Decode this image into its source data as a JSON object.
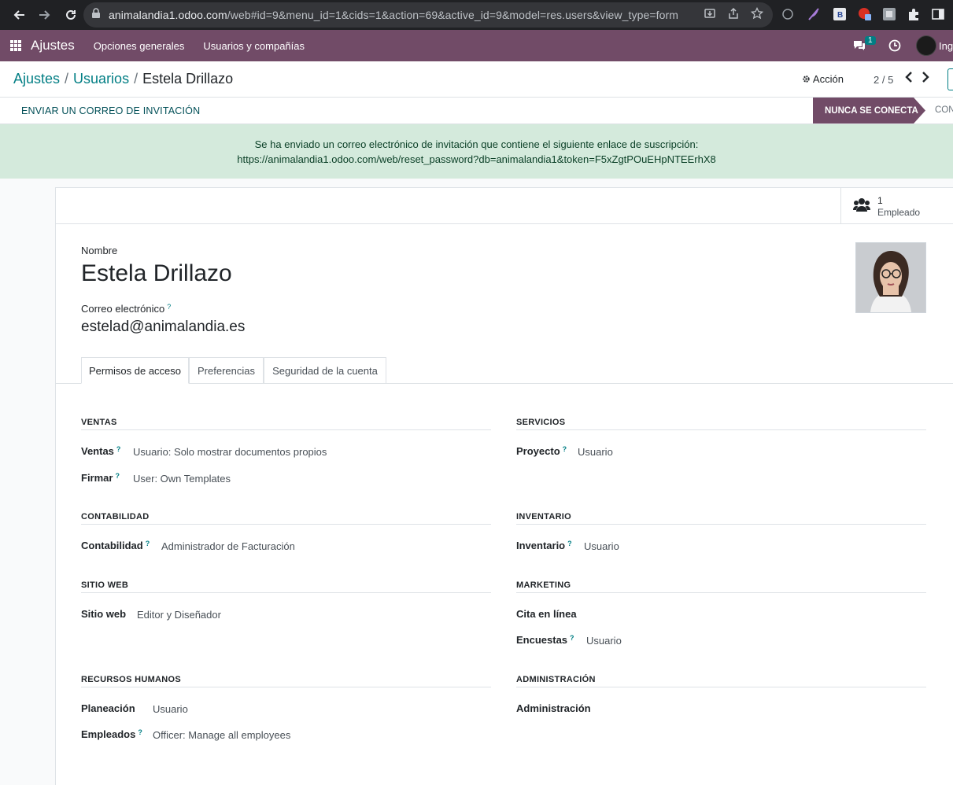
{
  "browser": {
    "url_host": "animalandia1.odoo.com",
    "url_rest": "/web#id=9&menu_id=1&cids=1&action=69&active_id=9&model=res.users&view_type=form"
  },
  "navbar": {
    "brand": "Ajustes",
    "menu": [
      "Opciones generales",
      "Usuarios y compañías"
    ],
    "chat_count": "1",
    "user_label": "Ing"
  },
  "breadcrumb": {
    "root": "Ajustes",
    "parent": "Usuarios",
    "current": "Estela Drillazo"
  },
  "control_panel": {
    "action_label": "Acción",
    "pager": "2 / 5"
  },
  "statusbar": {
    "invite_button": "ENVIAR UN CORREO DE INVITACIÓN",
    "stage_active": "NUNCA SE CONECTA",
    "stage_next": "CON"
  },
  "alert": {
    "line1": "Se ha enviado un correo electrónico de invitación que contiene el siguiente enlace de suscripción:",
    "line2": "https://animalandia1.odoo.com/web/reset_password?db=animalandia1&token=F5xZgtPOuEHpNTEErhX8"
  },
  "smart_button": {
    "count": "1",
    "label": "Empleado"
  },
  "form": {
    "name_label": "Nombre",
    "name": "Estela Drillazo",
    "email_label": "Correo electrónico",
    "email": "estelad@animalandia.es",
    "help_mark": "?"
  },
  "tabs": [
    "Permisos de acceso",
    "Preferencias",
    "Seguridad de la cuenta"
  ],
  "sections": {
    "ventas": {
      "title": "VENTAS",
      "rows": [
        {
          "label": "Ventas",
          "value": "Usuario: Solo mostrar documentos propios"
        },
        {
          "label": "Firmar",
          "value": "User: Own Templates"
        }
      ]
    },
    "servicios": {
      "title": "SERVICIOS",
      "rows": [
        {
          "label": "Proyecto",
          "value": "Usuario"
        }
      ]
    },
    "contabilidad": {
      "title": "CONTABILIDAD",
      "rows": [
        {
          "label": "Contabilidad",
          "value": "Administrador de Facturación"
        }
      ]
    },
    "inventario": {
      "title": "INVENTARIO",
      "rows": [
        {
          "label": "Inventario",
          "value": "Usuario"
        }
      ]
    },
    "sitio_web": {
      "title": "SITIO WEB",
      "rows": [
        {
          "label": "Sitio web",
          "value": "Editor y Diseñador"
        }
      ]
    },
    "marketing": {
      "title": "MARKETING",
      "rows": [
        {
          "label": "Cita en línea",
          "value": ""
        },
        {
          "label": "Encuestas",
          "value": "Usuario"
        }
      ]
    },
    "rrhh": {
      "title": "RECURSOS HUMANOS",
      "rows": [
        {
          "label": "Planeación",
          "value": "Usuario"
        },
        {
          "label": "Empleados",
          "value": "Officer: Manage all employees"
        }
      ]
    },
    "administracion": {
      "title": "ADMINISTRACIÓN",
      "rows": [
        {
          "label": "Administración",
          "value": ""
        }
      ]
    }
  }
}
